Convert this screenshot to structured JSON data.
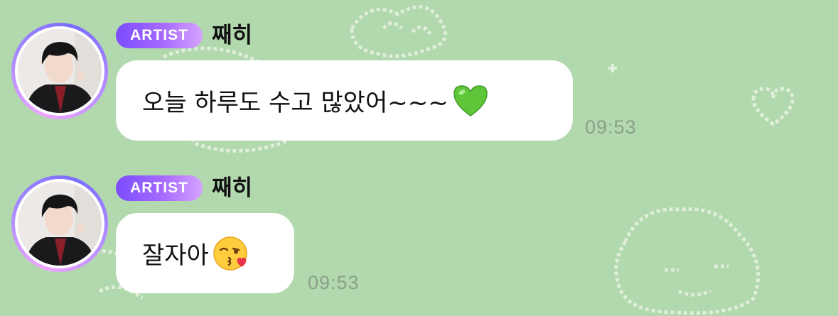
{
  "chat": {
    "messages": [
      {
        "badge": "ARTIST",
        "sender": "째히",
        "text": "오늘 하루도 수고 많았어~~~",
        "emoji": "green-heart-icon",
        "time": "09:53"
      },
      {
        "badge": "ARTIST",
        "sender": "째히",
        "text": "잘자아",
        "emoji": "face-blowing-kiss-icon",
        "time": "09:53"
      }
    ]
  },
  "colors": {
    "background": "#b2d8ae",
    "bubble": "#ffffff",
    "badge_gradient_start": "#7b4dff",
    "badge_gradient_end": "#d7a3ff",
    "timestamp": "#8aa088"
  }
}
